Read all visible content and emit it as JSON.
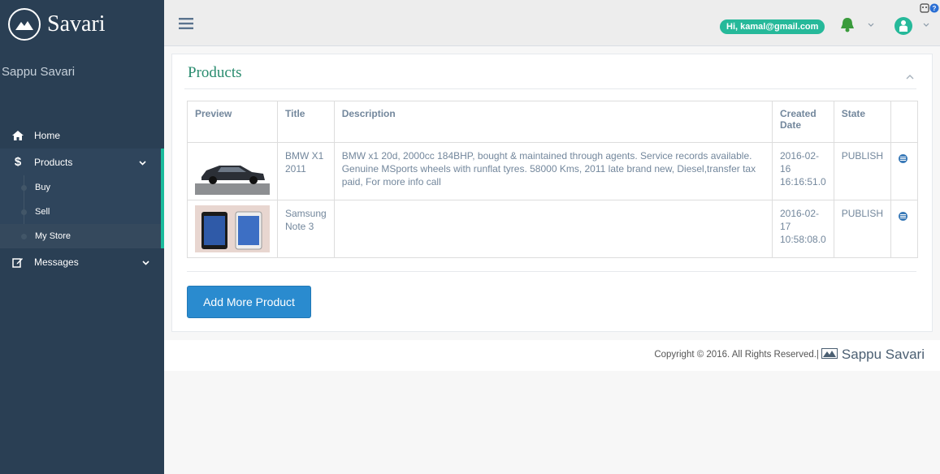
{
  "brand": {
    "name": "Savari",
    "site_name": "Sappu Savari"
  },
  "sidebar": {
    "items": [
      {
        "label": "Home",
        "icon": "home-icon"
      },
      {
        "label": "Products",
        "icon": "dollar-icon",
        "sub": [
          "Buy",
          "Sell",
          "My Store"
        ]
      },
      {
        "label": "Messages",
        "icon": "edit-icon"
      }
    ]
  },
  "topbar": {
    "user": "Hi, kamal@gmail.com"
  },
  "panel": {
    "title": "Products",
    "columns": [
      "Preview",
      "Title",
      "Description",
      "Created Date",
      "State",
      ""
    ],
    "rows": [
      {
        "title": "BMW X1 2011",
        "description": "BMW x1 20d, 2000cc 184BHP, bought & maintained through agents. Service records available. Genuine MSports wheels with runflat tyres. 58000 Kms, 2011 late brand new, Diesel,transfer tax paid, For more info call",
        "created": "2016-02-16 16:16:51.0",
        "state": "PUBLISH"
      },
      {
        "title": "Samsung Note 3",
        "description": "",
        "created": "2016-02-17 10:58:08.0",
        "state": "PUBLISH"
      }
    ],
    "add_button": "Add More Product"
  },
  "footer": {
    "copyright": "Copyright © 2016. All Rights Reserved.|",
    "brand": "Sappu Savari"
  },
  "colors": {
    "sidebar": "#2a3f54",
    "accent": "#26b99a",
    "button": "#2a8bcf",
    "title": "#2a8c6f"
  }
}
